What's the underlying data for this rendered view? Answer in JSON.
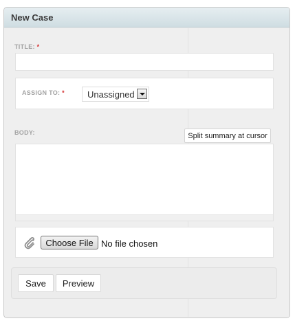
{
  "panel": {
    "title": "New Case"
  },
  "title_field": {
    "label": "TITLE:",
    "required_mark": "*",
    "value": ""
  },
  "assign_field": {
    "label": "ASSIGN TO:",
    "required_mark": "*",
    "selected": "Unassigned"
  },
  "body_field": {
    "label": "BODY:",
    "value": "",
    "split_button_label": "Split summary at cursor"
  },
  "attachment": {
    "icon": "paperclip-icon",
    "choose_label": "Choose File",
    "status": "No file chosen"
  },
  "actions": {
    "save_label": "Save",
    "preview_label": "Preview"
  },
  "colors": {
    "header_bg": "#d6e3e8",
    "required": "#d42f2f",
    "panel_bg": "#efefef"
  }
}
